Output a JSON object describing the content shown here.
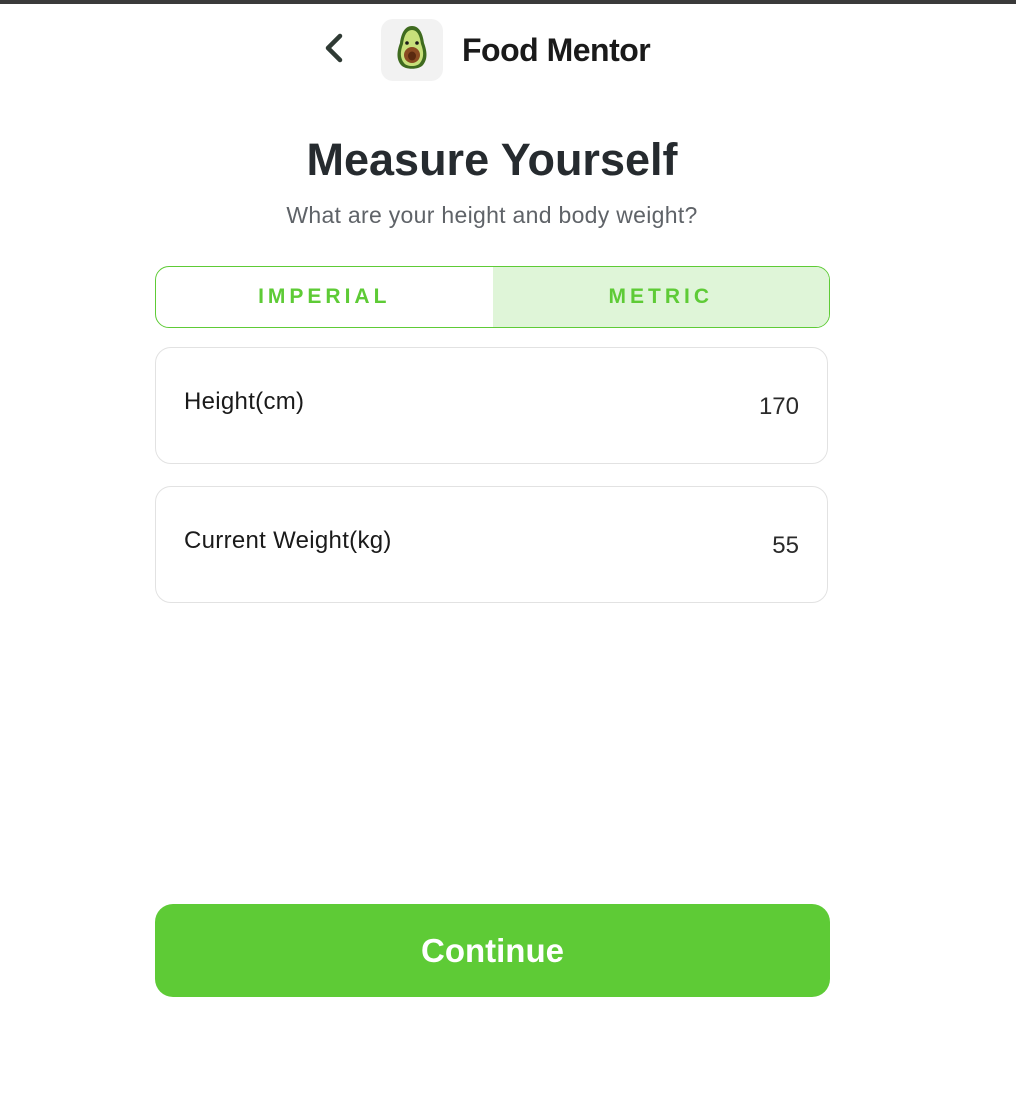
{
  "header": {
    "back_icon": "chevron-left-icon",
    "logo_icon": "avocado-icon",
    "app_title": "Food Mentor"
  },
  "page": {
    "title": "Measure Yourself",
    "subtitle": "What are your height and body weight?"
  },
  "unit_toggle": {
    "options": [
      {
        "label": "IMPERIAL",
        "selected": false
      },
      {
        "label": "METRIC",
        "selected": true
      }
    ]
  },
  "fields": {
    "height": {
      "label": "Height(cm)",
      "value": "170"
    },
    "weight": {
      "label": "Current Weight(kg)",
      "value": "55"
    }
  },
  "actions": {
    "continue_label": "Continue"
  },
  "colors": {
    "accent": "#5ecb36",
    "accent_light": "#dff5d8",
    "title_text": "#262b2f",
    "subtitle_text": "#5f6368"
  }
}
